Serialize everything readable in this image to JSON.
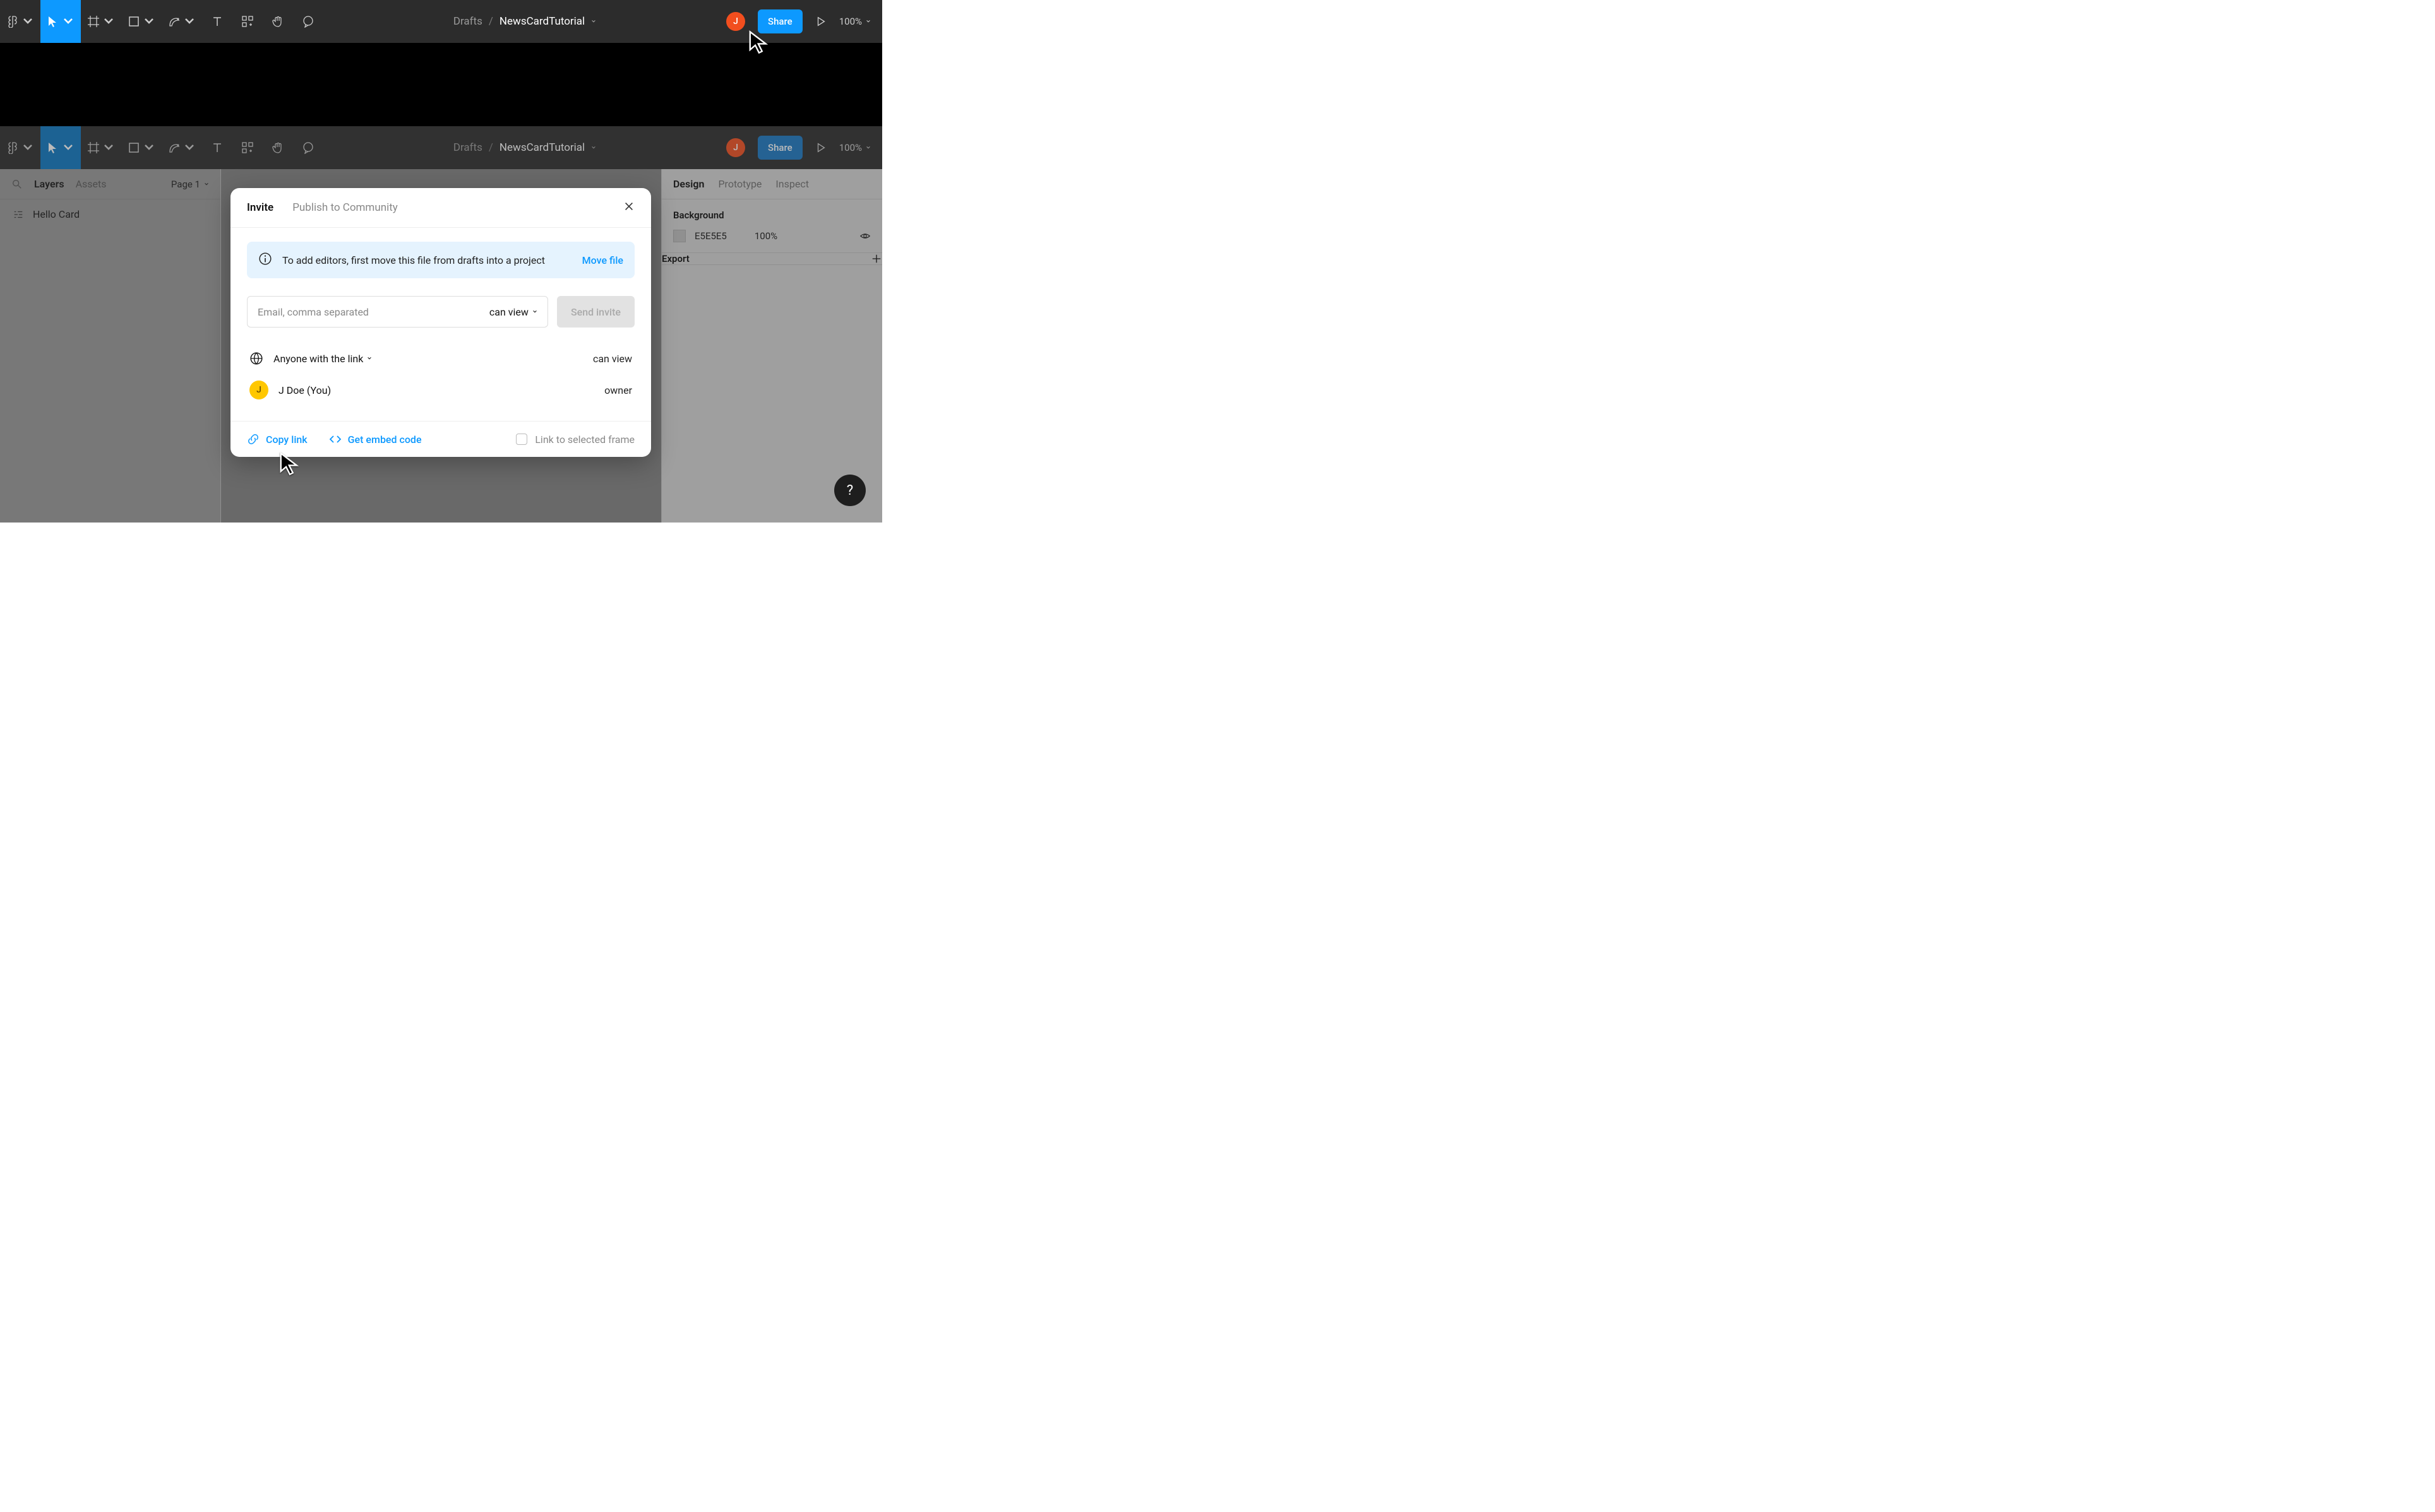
{
  "breadcrumb": {
    "drafts": "Drafts",
    "slash": "/",
    "file": "NewsCardTutorial"
  },
  "avatar": {
    "initial": "J"
  },
  "share_label": "Share",
  "zoom": "100%",
  "left_panel": {
    "search_placeholder": "",
    "tab_layers": "Layers",
    "tab_assets": "Assets",
    "page": "Page 1",
    "layer": "Hello Card"
  },
  "right_panel": {
    "tab_design": "Design",
    "tab_prototype": "Prototype",
    "tab_inspect": "Inspect",
    "bg_title": "Background",
    "bg_hex": "E5E5E5",
    "bg_opacity": "100%",
    "export_title": "Export"
  },
  "modal": {
    "tab_invite": "Invite",
    "tab_publish": "Publish to Community",
    "banner_text": "To add editors, first move this file from drafts into a project",
    "banner_action": "Move file",
    "email_placeholder": "Email, comma separated",
    "perm_default": "can view",
    "send": "Send invite",
    "anyone_link": "Anyone with the link",
    "anyone_perm": "can view",
    "owner_name": "J Doe (You)",
    "owner_perm": "owner",
    "copy_link": "Copy link",
    "embed": "Get embed code",
    "selected_frame": "Link to selected frame"
  },
  "help": "?"
}
